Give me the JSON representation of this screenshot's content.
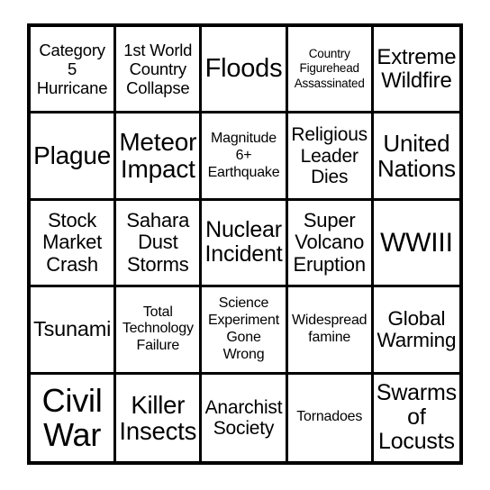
{
  "card": {
    "type": "bingo-card",
    "grid": {
      "rows": 5,
      "columns": 5
    },
    "colors": {
      "background": "#ffffff",
      "border": "#000000",
      "text": "#000000"
    },
    "cells": [
      {
        "row": 1,
        "col": 1,
        "text": "Category\n5\nHurricane",
        "size": "m",
        "marked": false
      },
      {
        "row": 1,
        "col": 2,
        "text": "1st World\nCountry\nCollapse",
        "size": "m",
        "marked": false
      },
      {
        "row": 1,
        "col": 3,
        "text": "Floods",
        "size": "xxl",
        "marked": false
      },
      {
        "row": 1,
        "col": 4,
        "text": "Country\nFigurehead\nAssassinated",
        "size": "xs",
        "marked": false
      },
      {
        "row": 1,
        "col": 5,
        "text": "Extreme\nWildfire",
        "size": "xl",
        "marked": false
      },
      {
        "row": 2,
        "col": 1,
        "text": "Plague",
        "size": "xxl",
        "marked": false
      },
      {
        "row": 2,
        "col": 2,
        "text": "Meteor\nImpact",
        "size": "xxl",
        "marked": false
      },
      {
        "row": 2,
        "col": 3,
        "text": "Magnitude\n6+\nEarthquake",
        "size": "s",
        "marked": false
      },
      {
        "row": 2,
        "col": 4,
        "text": "Religious\nLeader\nDies",
        "size": "l",
        "marked": false
      },
      {
        "row": 2,
        "col": 5,
        "text": "United\nNations",
        "size": "xl",
        "marked": false
      },
      {
        "row": 3,
        "col": 1,
        "text": "Stock\nMarket\nCrash",
        "size": "l",
        "marked": false
      },
      {
        "row": 3,
        "col": 2,
        "text": "Sahara\nDust\nStorms",
        "size": "l",
        "marked": false
      },
      {
        "row": 3,
        "col": 3,
        "text": "Nuclear\nIncident",
        "size": "xl",
        "marked": false
      },
      {
        "row": 3,
        "col": 4,
        "text": "Super\nVolcano\nEruption",
        "size": "l",
        "marked": false
      },
      {
        "row": 3,
        "col": 5,
        "text": "WWIII",
        "size": "xxl",
        "marked": false
      },
      {
        "row": 4,
        "col": 1,
        "text": "Tsunami",
        "size": "xl",
        "marked": false
      },
      {
        "row": 4,
        "col": 2,
        "text": "Total\nTechnology\nFailure",
        "size": "s",
        "marked": false
      },
      {
        "row": 4,
        "col": 3,
        "text": "Science\nExperiment\nGone\nWrong",
        "size": "s",
        "marked": false
      },
      {
        "row": 4,
        "col": 4,
        "text": "Widespread\nfamine",
        "size": "s",
        "marked": false
      },
      {
        "row": 4,
        "col": 5,
        "text": "Global\nWarming",
        "size": "xl",
        "marked": false
      },
      {
        "row": 5,
        "col": 1,
        "text": "Civil\nWar",
        "size": "huge",
        "marked": false
      },
      {
        "row": 5,
        "col": 2,
        "text": "Killer\nInsects",
        "size": "xxl",
        "marked": false
      },
      {
        "row": 5,
        "col": 3,
        "text": "Anarchist\nSociety",
        "size": "l",
        "marked": false
      },
      {
        "row": 5,
        "col": 4,
        "text": "Tornadoes",
        "size": "s",
        "marked": false
      },
      {
        "row": 5,
        "col": 5,
        "text": "Swarms\nof\nLocusts",
        "size": "xl",
        "marked": false
      }
    ]
  }
}
